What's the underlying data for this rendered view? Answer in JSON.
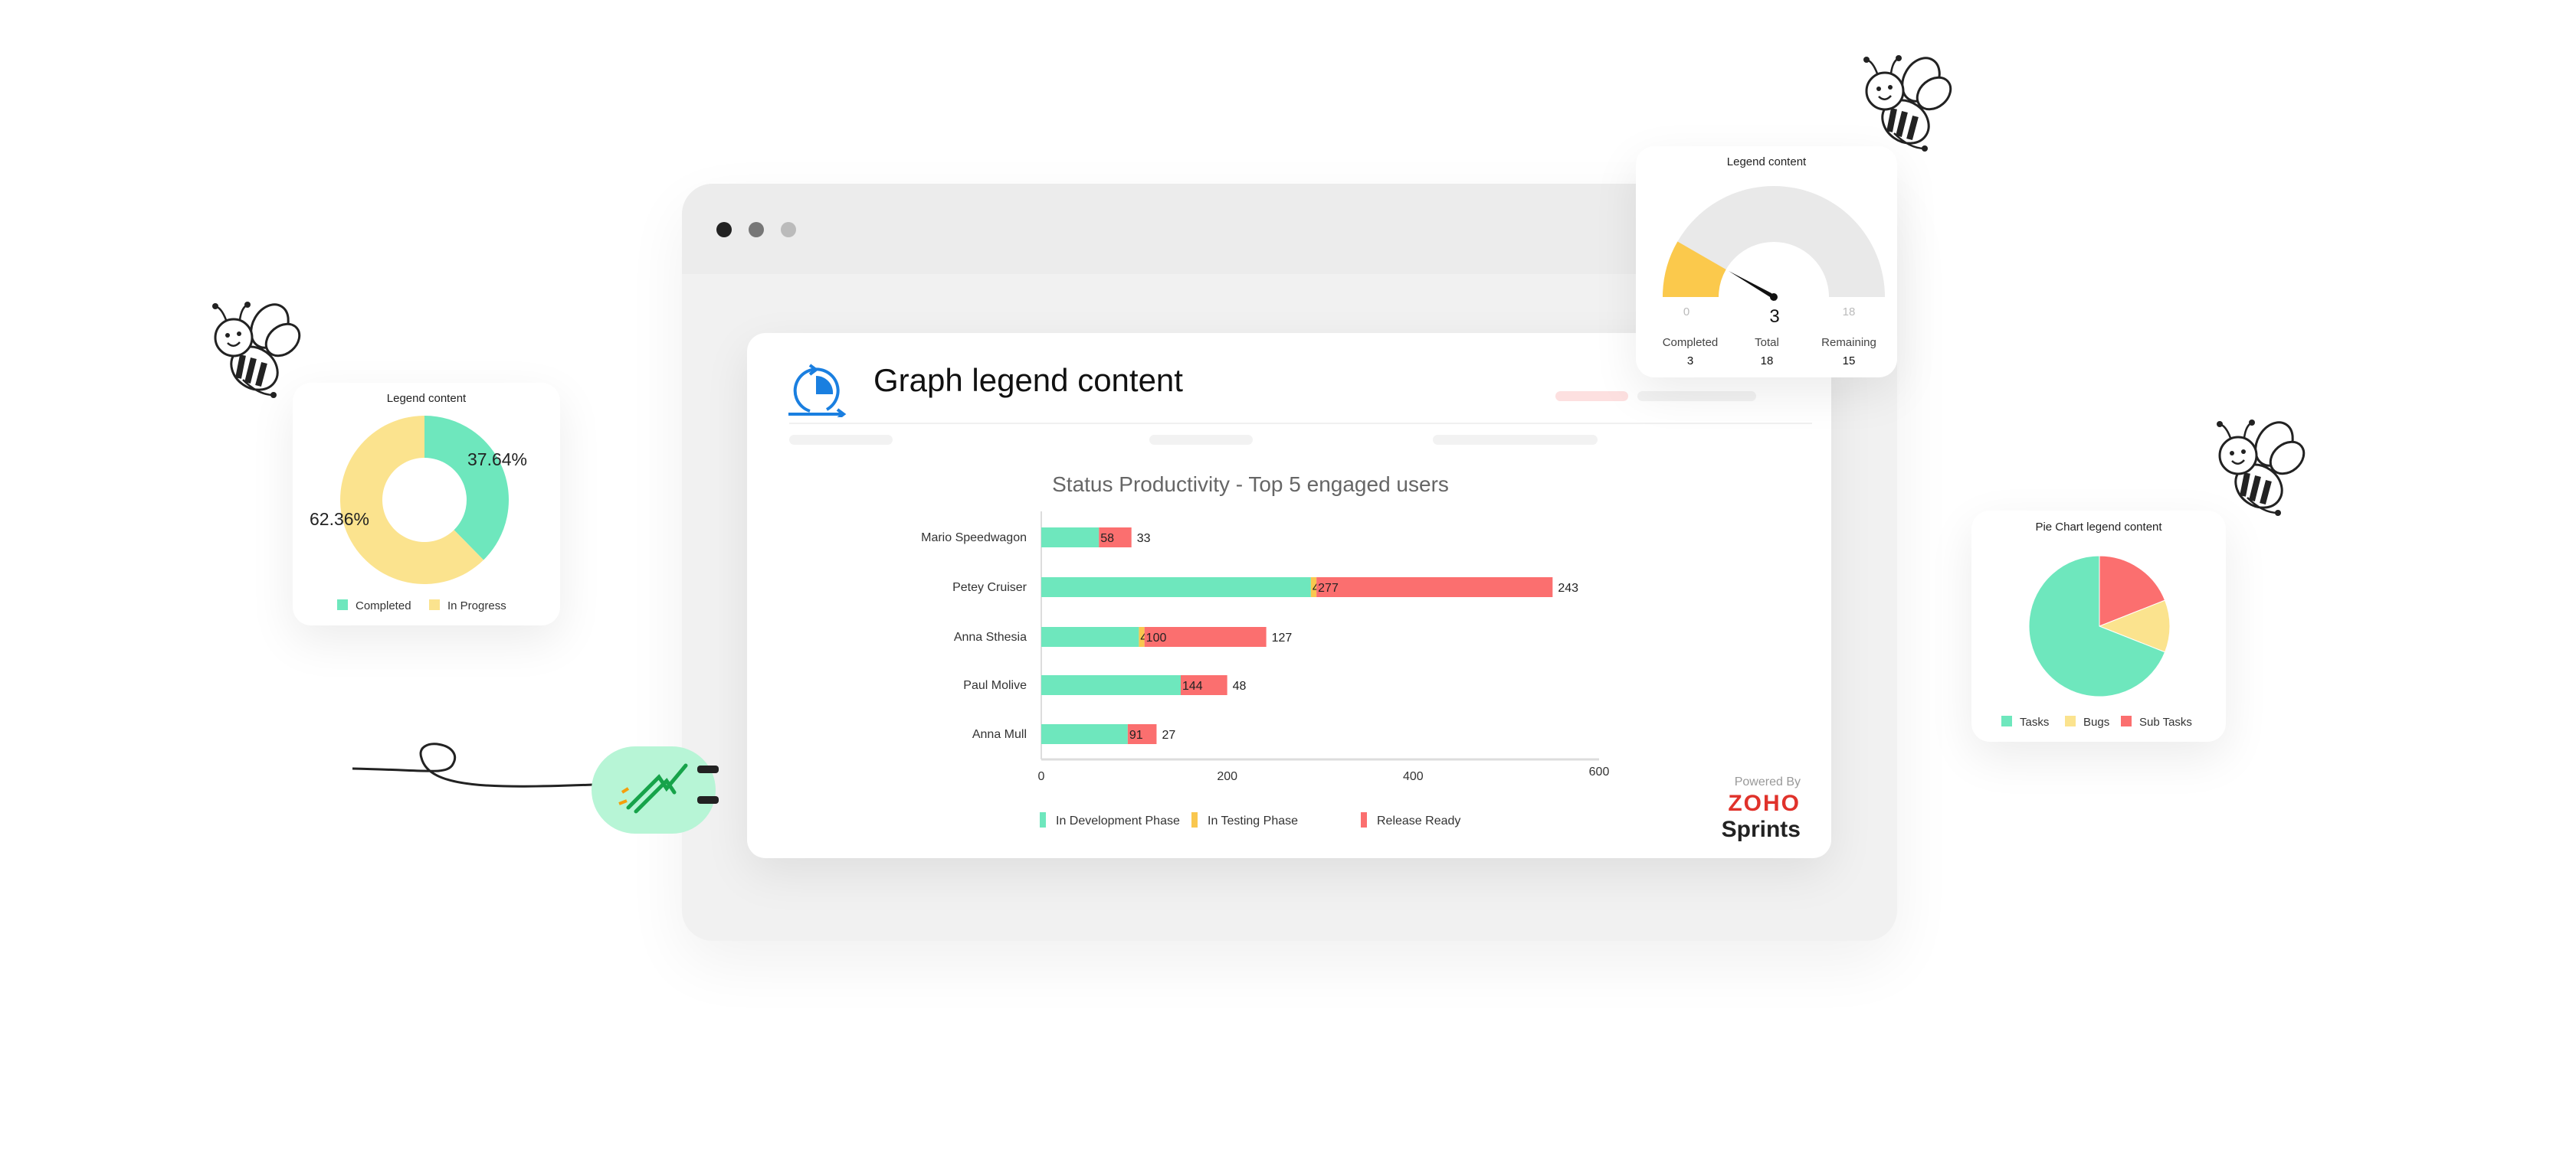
{
  "main_card": {
    "title": "Graph legend content",
    "icon": "sprint-cycle-icon",
    "powered_by": "Powered By",
    "brand_zoho": "ZOHO",
    "brand_product": "Sprints"
  },
  "chart_data": [
    {
      "type": "bar",
      "orientation": "horizontal-stacked",
      "title": "Status Productivity - Top 5 engaged users",
      "categories": [
        "Mario Speedwagon",
        "Petey Cruiser",
        "Anna Sthesia",
        "Paul Molive",
        "Anna Mull"
      ],
      "series": [
        {
          "name": "In Development Phase",
          "color": "#6ee7bd",
          "values": [
            62,
            290,
            105,
            150,
            93
          ],
          "labels": [
            "",
            "",
            "",
            "",
            ""
          ]
        },
        {
          "name": "In Testing Phase",
          "color": "#f9c74f",
          "values": [
            0,
            6,
            6,
            0,
            0
          ],
          "labels": [
            "",
            "4",
            "4",
            "",
            ""
          ]
        },
        {
          "name": "Release Ready",
          "color": "#fb6f6f",
          "values": [
            35,
            254,
            131,
            50,
            31
          ],
          "labels": [
            "58",
            "277",
            "100",
            "144",
            "91"
          ]
        }
      ],
      "end_labels": [
        "33",
        "243",
        "127",
        "48",
        "27"
      ],
      "xlim": [
        0,
        600
      ],
      "xticks": [
        "0",
        "200",
        "400",
        "600"
      ],
      "legend": "bottom"
    },
    {
      "type": "pie",
      "variant": "donut",
      "title": "Legend content",
      "series": [
        {
          "name": "Completed",
          "value": 37.64,
          "label": "37.64%",
          "color": "#6ee7bd"
        },
        {
          "name": "In Progress",
          "value": 62.36,
          "label": "62.36%",
          "color": "#fbe38e"
        }
      ],
      "legend": "bottom"
    },
    {
      "type": "gauge",
      "title": "Legend content",
      "value": 3,
      "min_label": "0",
      "max_label": "18",
      "min": 0,
      "max": 18,
      "value_label": "3",
      "fill_color": "#fbc94c",
      "track_color": "#e9e9e9",
      "stats": [
        {
          "label": "Completed",
          "value": "3"
        },
        {
          "label": "Total",
          "value": "18"
        },
        {
          "label": "Remaining",
          "value": "15"
        }
      ]
    },
    {
      "type": "pie",
      "title": "Pie Chart legend content",
      "series": [
        {
          "name": "Tasks",
          "value": 69,
          "color": "#6ee7bd"
        },
        {
          "name": "Bugs",
          "value": 12,
          "color": "#fbe38e"
        },
        {
          "name": "Sub Tasks",
          "value": 19,
          "color": "#fb6f6f"
        }
      ],
      "legend": "bottom"
    }
  ],
  "decor": {
    "mascot": "bee-icon",
    "plug": "plug-icon"
  }
}
